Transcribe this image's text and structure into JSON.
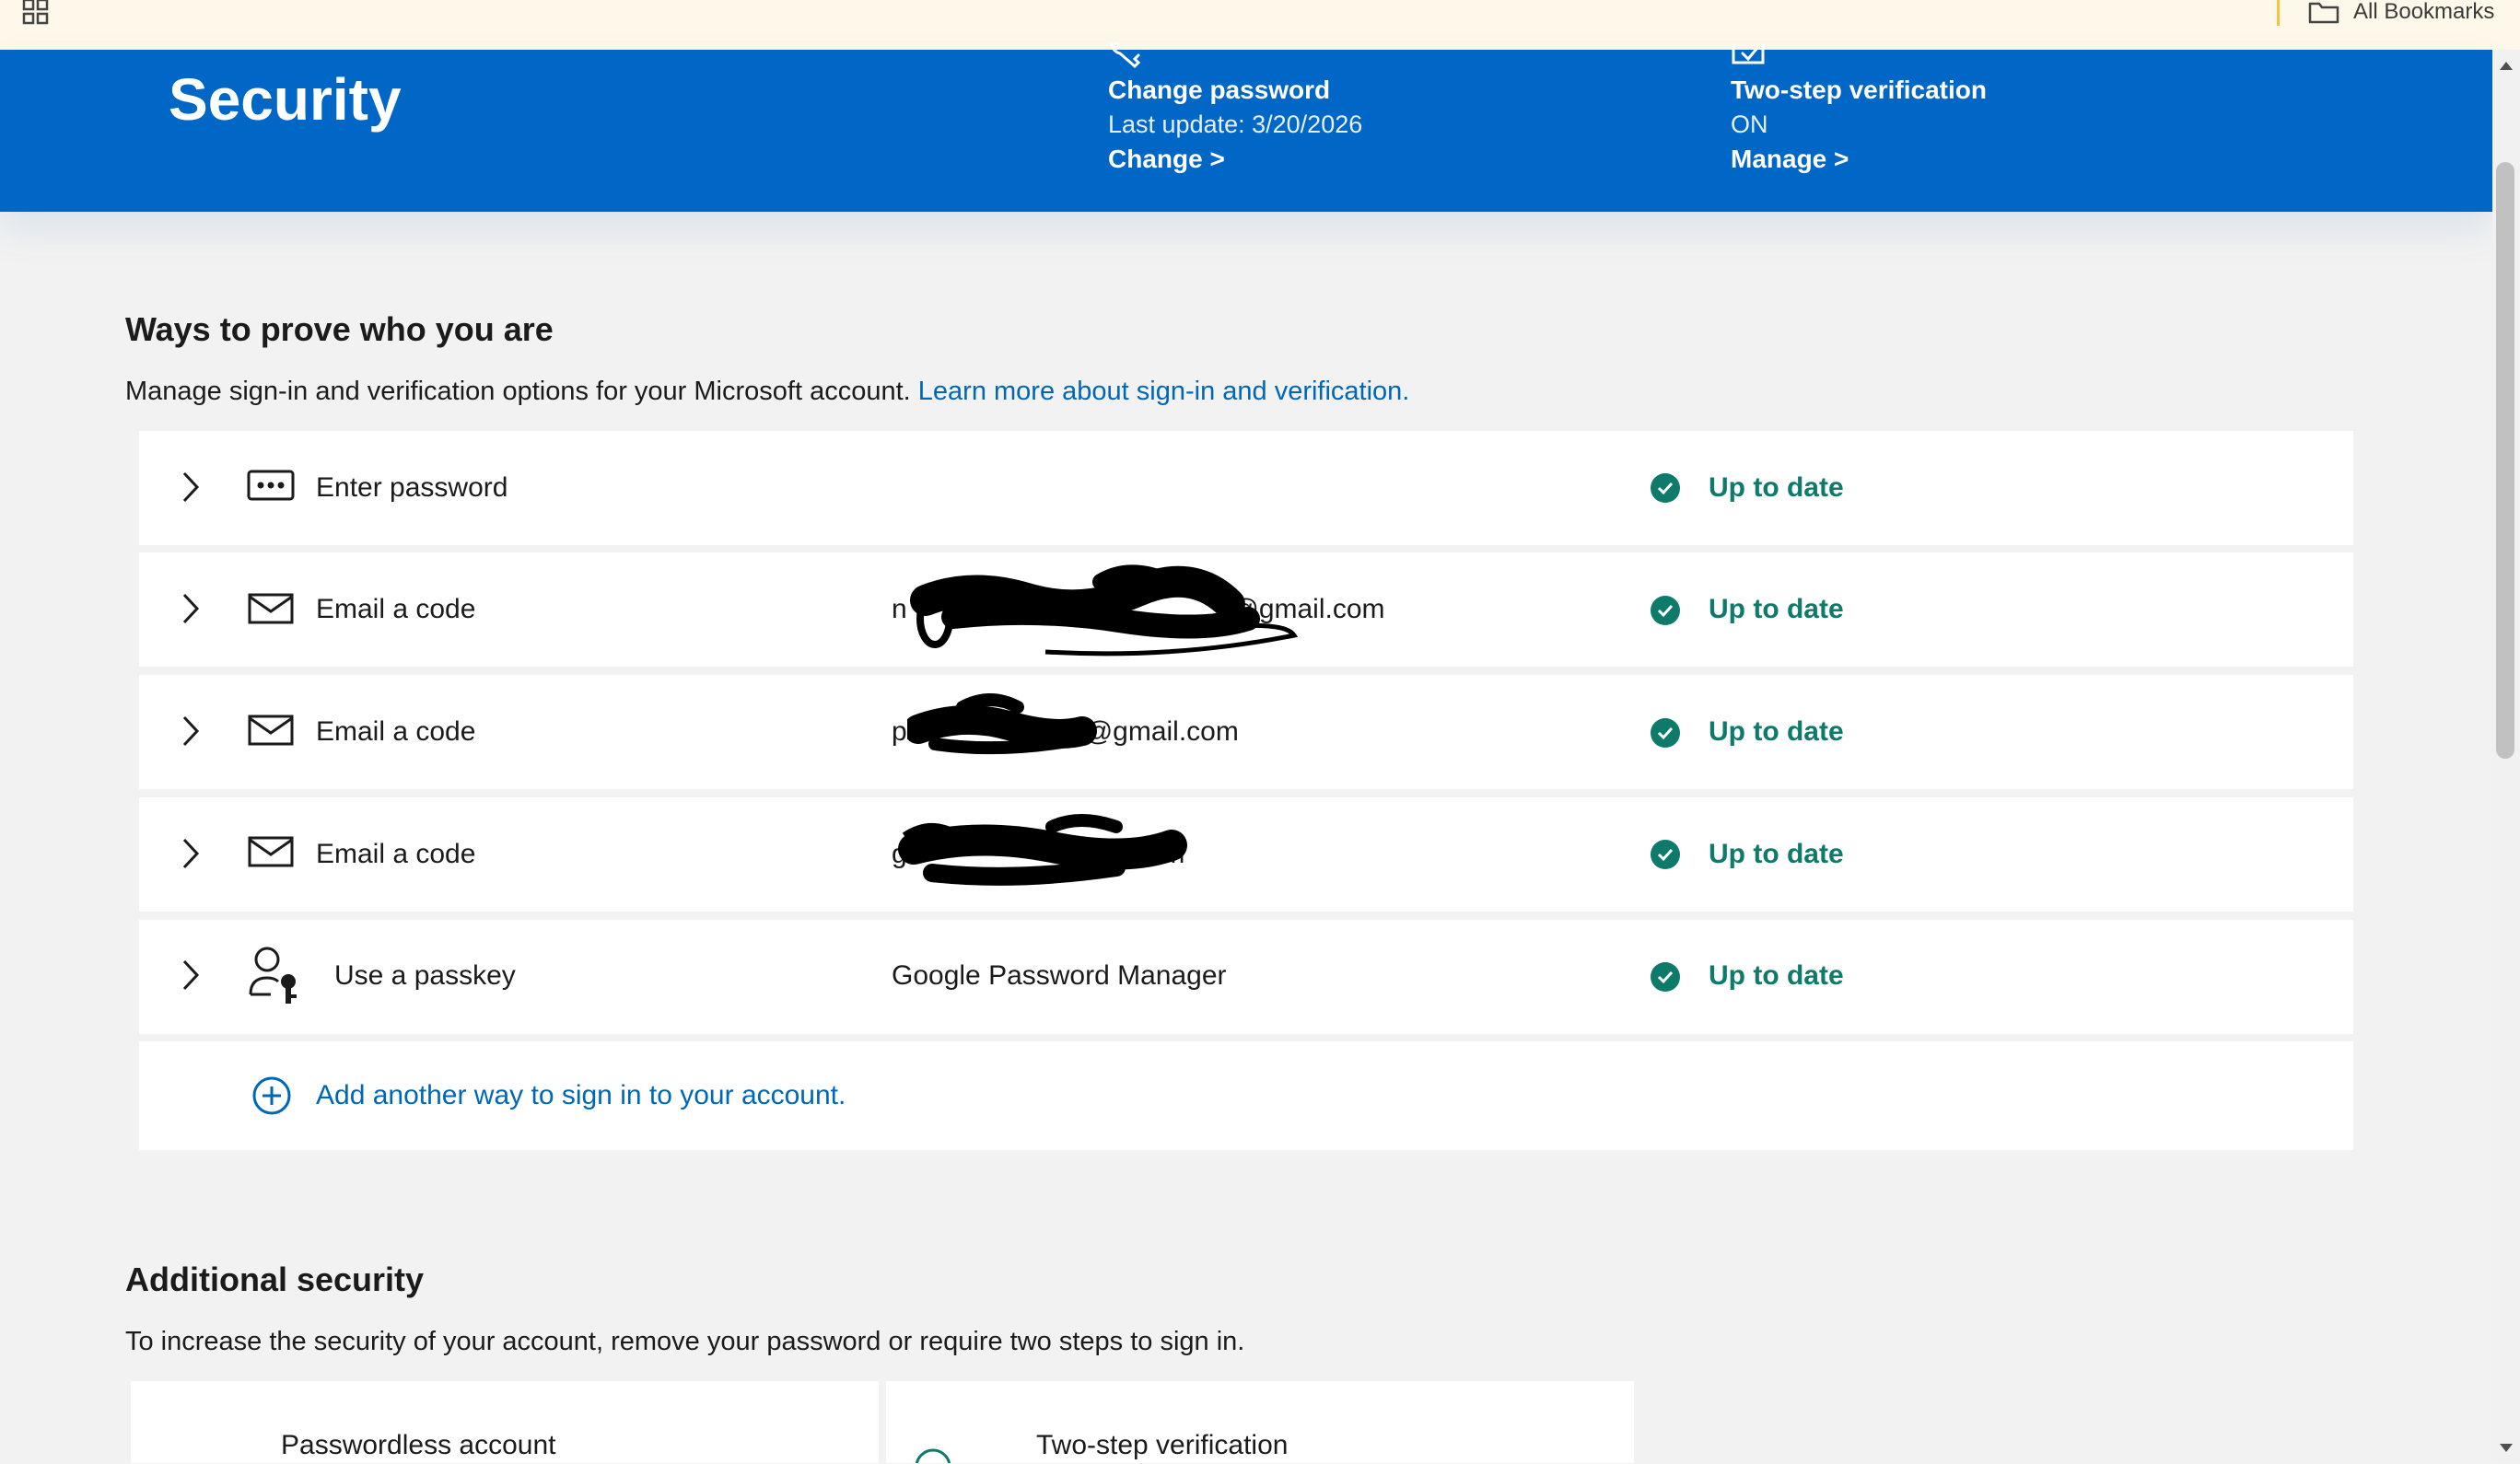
{
  "bookmarks": {
    "all_bookmarks_label": "All Bookmarks"
  },
  "header": {
    "title": "Security",
    "change_password": {
      "title": "Change password",
      "subtitle": "Last update: 3/20/2026",
      "link": "Change >"
    },
    "two_step": {
      "title": "Two-step verification",
      "subtitle": "ON",
      "link": "Manage >"
    }
  },
  "ways": {
    "title": "Ways to prove who you are",
    "description": "Manage sign-in and verification options for your Microsoft account.",
    "learn_more": "Learn more about sign-in and verification.",
    "methods": [
      {
        "label": "Enter password",
        "detail": "",
        "status": "Up to date",
        "icon": "password-icon"
      },
      {
        "label": "Email a code",
        "detail": "n",
        "detail_suffix": "a@gmail.com",
        "status": "Up to date",
        "icon": "mail-icon"
      },
      {
        "label": "Email a code",
        "detail": "p",
        "detail_suffix": "@gmail.com",
        "status": "Up to date",
        "icon": "mail-icon"
      },
      {
        "label": "Email a code",
        "detail": "g",
        "detail_suffix": "om",
        "status": "Up to date",
        "icon": "mail-icon"
      },
      {
        "label": "Use a passkey",
        "detail": "Google Password Manager",
        "status": "Up to date",
        "icon": "passkey-icon"
      }
    ],
    "add_another": "Add another way to sign in to your account."
  },
  "additional": {
    "title": "Additional security",
    "description": "To increase the security of your account, remove your password or require two steps to sign in.",
    "cards": [
      {
        "title": "Passwordless account"
      },
      {
        "title": "Two-step verification"
      }
    ]
  },
  "colors": {
    "brand_blue": "#0067c7",
    "status_green": "#0e7a6a",
    "link_blue": "#0067b8"
  }
}
